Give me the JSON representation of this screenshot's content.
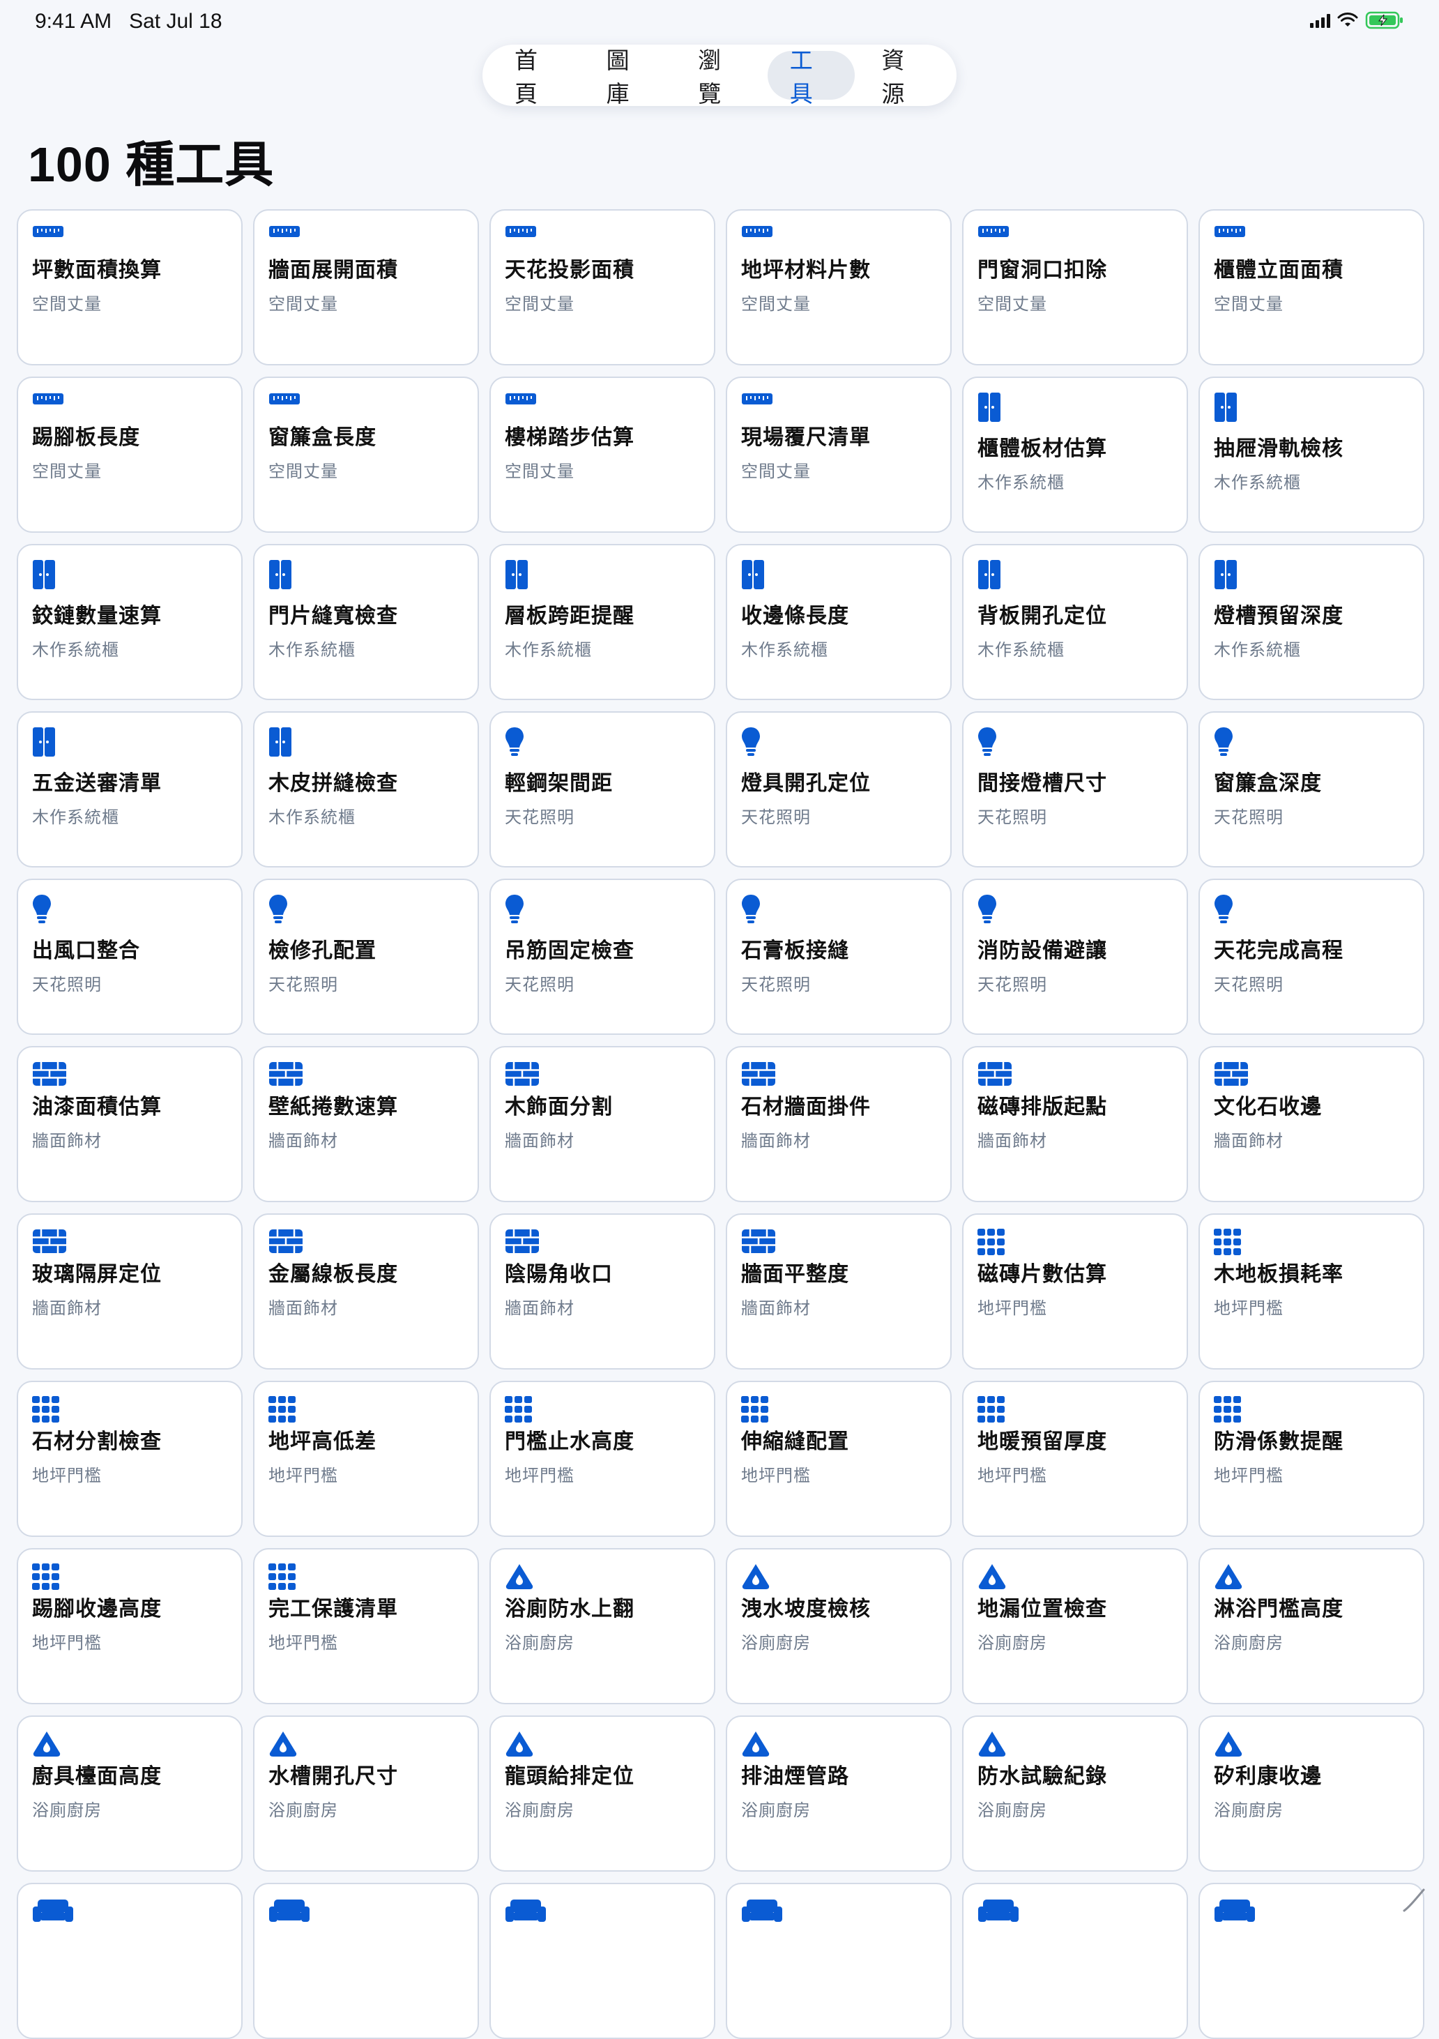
{
  "status": {
    "time": "9:41 AM",
    "date": "Sat Jul 18",
    "icons": [
      "cellular-signal-icon",
      "wifi-icon",
      "battery-charging-icon"
    ],
    "battery_color": "#34c759"
  },
  "nav": {
    "tabs": [
      {
        "label": "首頁",
        "active": false
      },
      {
        "label": "圖庫",
        "active": false
      },
      {
        "label": "瀏覽",
        "active": false
      },
      {
        "label": "工具",
        "active": true
      },
      {
        "label": "資源",
        "active": false
      }
    ],
    "accent": "#0a5bd3"
  },
  "page": {
    "title": "100 種工具"
  },
  "tools": [
    {
      "title": "坪數面積換算",
      "category": "空間丈量",
      "icon": "ruler-icon"
    },
    {
      "title": "牆面展開面積",
      "category": "空間丈量",
      "icon": "ruler-icon"
    },
    {
      "title": "天花投影面積",
      "category": "空間丈量",
      "icon": "ruler-icon"
    },
    {
      "title": "地坪材料片數",
      "category": "空間丈量",
      "icon": "ruler-icon"
    },
    {
      "title": "門窗洞口扣除",
      "category": "空間丈量",
      "icon": "ruler-icon"
    },
    {
      "title": "櫃體立面面積",
      "category": "空間丈量",
      "icon": "ruler-icon"
    },
    {
      "title": "踢腳板長度",
      "category": "空間丈量",
      "icon": "ruler-icon"
    },
    {
      "title": "窗簾盒長度",
      "category": "空間丈量",
      "icon": "ruler-icon"
    },
    {
      "title": "樓梯踏步估算",
      "category": "空間丈量",
      "icon": "ruler-icon"
    },
    {
      "title": "現場覆尺清單",
      "category": "空間丈量",
      "icon": "ruler-icon"
    },
    {
      "title": "櫃體板材估算",
      "category": "木作系統櫃",
      "icon": "cabinet-icon"
    },
    {
      "title": "抽屜滑軌檢核",
      "category": "木作系統櫃",
      "icon": "cabinet-icon"
    },
    {
      "title": "鉸鏈數量速算",
      "category": "木作系統櫃",
      "icon": "cabinet-icon"
    },
    {
      "title": "門片縫寬檢查",
      "category": "木作系統櫃",
      "icon": "cabinet-icon"
    },
    {
      "title": "層板跨距提醒",
      "category": "木作系統櫃",
      "icon": "cabinet-icon"
    },
    {
      "title": "收邊條長度",
      "category": "木作系統櫃",
      "icon": "cabinet-icon"
    },
    {
      "title": "背板開孔定位",
      "category": "木作系統櫃",
      "icon": "cabinet-icon"
    },
    {
      "title": "燈槽預留深度",
      "category": "木作系統櫃",
      "icon": "cabinet-icon"
    },
    {
      "title": "五金送審清單",
      "category": "木作系統櫃",
      "icon": "cabinet-icon"
    },
    {
      "title": "木皮拼縫檢查",
      "category": "木作系統櫃",
      "icon": "cabinet-icon"
    },
    {
      "title": "輕鋼架間距",
      "category": "天花照明",
      "icon": "lightbulb-icon"
    },
    {
      "title": "燈具開孔定位",
      "category": "天花照明",
      "icon": "lightbulb-icon"
    },
    {
      "title": "間接燈槽尺寸",
      "category": "天花照明",
      "icon": "lightbulb-icon"
    },
    {
      "title": "窗簾盒深度",
      "category": "天花照明",
      "icon": "lightbulb-icon"
    },
    {
      "title": "出風口整合",
      "category": "天花照明",
      "icon": "lightbulb-icon"
    },
    {
      "title": "檢修孔配置",
      "category": "天花照明",
      "icon": "lightbulb-icon"
    },
    {
      "title": "吊筋固定檢查",
      "category": "天花照明",
      "icon": "lightbulb-icon"
    },
    {
      "title": "石膏板接縫",
      "category": "天花照明",
      "icon": "lightbulb-icon"
    },
    {
      "title": "消防設備避讓",
      "category": "天花照明",
      "icon": "lightbulb-icon"
    },
    {
      "title": "天花完成高程",
      "category": "天花照明",
      "icon": "lightbulb-icon"
    },
    {
      "title": "油漆面積估算",
      "category": "牆面飾材",
      "icon": "wall-tiles-icon"
    },
    {
      "title": "壁紙捲數速算",
      "category": "牆面飾材",
      "icon": "wall-tiles-icon"
    },
    {
      "title": "木飾面分割",
      "category": "牆面飾材",
      "icon": "wall-tiles-icon"
    },
    {
      "title": "石材牆面掛件",
      "category": "牆面飾材",
      "icon": "wall-tiles-icon"
    },
    {
      "title": "磁磚排版起點",
      "category": "牆面飾材",
      "icon": "wall-tiles-icon"
    },
    {
      "title": "文化石收邊",
      "category": "牆面飾材",
      "icon": "wall-tiles-icon"
    },
    {
      "title": "玻璃隔屏定位",
      "category": "牆面飾材",
      "icon": "wall-tiles-icon"
    },
    {
      "title": "金屬線板長度",
      "category": "牆面飾材",
      "icon": "wall-tiles-icon"
    },
    {
      "title": "陰陽角收口",
      "category": "牆面飾材",
      "icon": "wall-tiles-icon"
    },
    {
      "title": "牆面平整度",
      "category": "牆面飾材",
      "icon": "wall-tiles-icon"
    },
    {
      "title": "磁磚片數估算",
      "category": "地坪門檻",
      "icon": "floor-grid-icon"
    },
    {
      "title": "木地板損耗率",
      "category": "地坪門檻",
      "icon": "floor-grid-icon"
    },
    {
      "title": "石材分割檢查",
      "category": "地坪門檻",
      "icon": "floor-grid-icon"
    },
    {
      "title": "地坪高低差",
      "category": "地坪門檻",
      "icon": "floor-grid-icon"
    },
    {
      "title": "門檻止水高度",
      "category": "地坪門檻",
      "icon": "floor-grid-icon"
    },
    {
      "title": "伸縮縫配置",
      "category": "地坪門檻",
      "icon": "floor-grid-icon"
    },
    {
      "title": "地暖預留厚度",
      "category": "地坪門檻",
      "icon": "floor-grid-icon"
    },
    {
      "title": "防滑係數提醒",
      "category": "地坪門檻",
      "icon": "floor-grid-icon"
    },
    {
      "title": "踢腳收邊高度",
      "category": "地坪門檻",
      "icon": "floor-grid-icon"
    },
    {
      "title": "完工保護清單",
      "category": "地坪門檻",
      "icon": "floor-grid-icon"
    },
    {
      "title": "浴廁防水上翻",
      "category": "浴廁廚房",
      "icon": "water-drop-icon"
    },
    {
      "title": "洩水坡度檢核",
      "category": "浴廁廚房",
      "icon": "water-drop-icon"
    },
    {
      "title": "地漏位置檢查",
      "category": "浴廁廚房",
      "icon": "water-drop-icon"
    },
    {
      "title": "淋浴門檻高度",
      "category": "浴廁廚房",
      "icon": "water-drop-icon"
    },
    {
      "title": "廚具檯面高度",
      "category": "浴廁廚房",
      "icon": "water-drop-icon"
    },
    {
      "title": "水槽開孔尺寸",
      "category": "浴廁廚房",
      "icon": "water-drop-icon"
    },
    {
      "title": "龍頭給排定位",
      "category": "浴廁廚房",
      "icon": "water-drop-icon"
    },
    {
      "title": "排油煙管路",
      "category": "浴廁廚房",
      "icon": "water-drop-icon"
    },
    {
      "title": "防水試驗紀錄",
      "category": "浴廁廚房",
      "icon": "water-drop-icon"
    },
    {
      "title": "矽利康收邊",
      "category": "浴廁廚房",
      "icon": "water-drop-icon"
    },
    {
      "title": "",
      "category": "",
      "icon": "sofa-icon"
    },
    {
      "title": "",
      "category": "",
      "icon": "sofa-icon"
    },
    {
      "title": "",
      "category": "",
      "icon": "sofa-icon"
    },
    {
      "title": "",
      "category": "",
      "icon": "sofa-icon"
    },
    {
      "title": "",
      "category": "",
      "icon": "sofa-icon"
    },
    {
      "title": "",
      "category": "",
      "icon": "sofa-icon"
    }
  ]
}
